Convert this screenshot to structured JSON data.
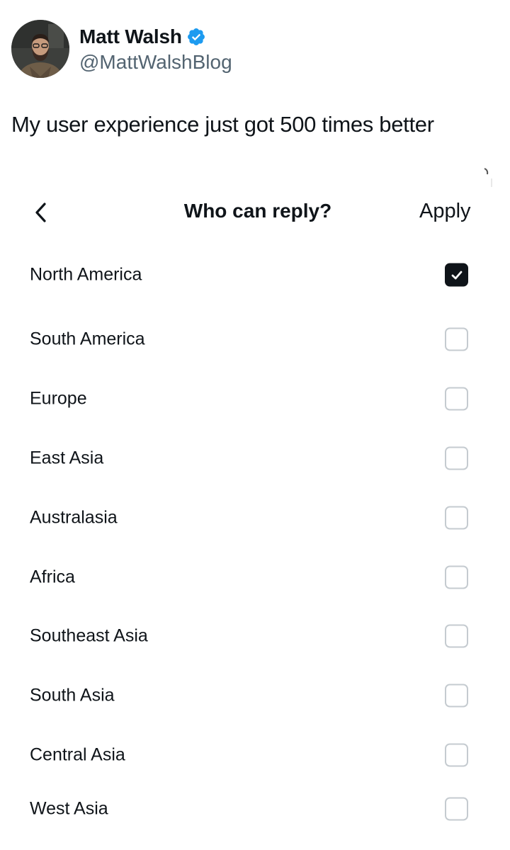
{
  "author": {
    "display_name": "Matt Walsh",
    "handle": "@MattWalshBlog",
    "avatar_icon": "profile-photo",
    "verified_icon": "verified-badge-icon",
    "verified_color": "#1d9bf0"
  },
  "tweet": {
    "text": "My user experience just got 500 times better"
  },
  "reply_settings": {
    "back_icon": "chevron-left-icon",
    "title": "Who can reply?",
    "apply_label": "Apply",
    "options": [
      {
        "label": "North America",
        "checked": true
      },
      {
        "label": "South America",
        "checked": false
      },
      {
        "label": "Europe",
        "checked": false
      },
      {
        "label": "East Asia",
        "checked": false
      },
      {
        "label": "Australasia",
        "checked": false
      },
      {
        "label": "Africa",
        "checked": false
      },
      {
        "label": "Southeast Asia",
        "checked": false
      },
      {
        "label": "South Asia",
        "checked": false
      },
      {
        "label": "Central Asia",
        "checked": false
      },
      {
        "label": "West Asia",
        "checked": false
      }
    ]
  },
  "colors": {
    "text_primary": "#0f1419",
    "text_secondary": "#536471",
    "checkbox_border": "#c5cbd0",
    "checkbox_checked": "#0f1419"
  }
}
